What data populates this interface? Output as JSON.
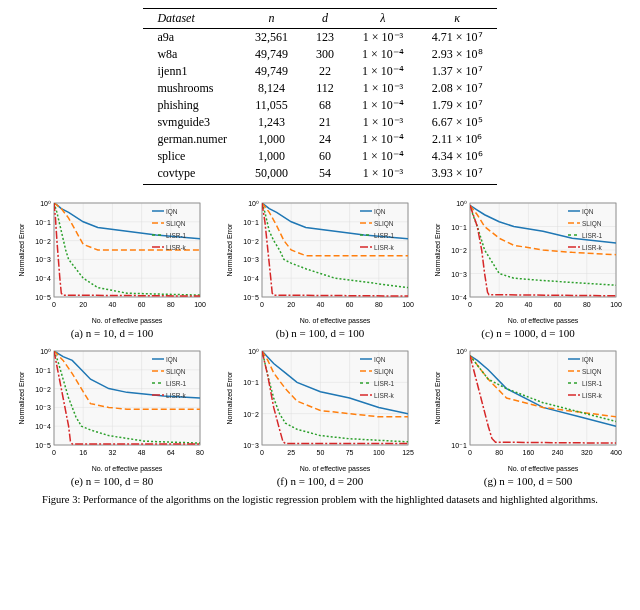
{
  "table": {
    "headers": [
      "Dataset",
      "n",
      "d",
      "λ",
      "κ"
    ],
    "rows": [
      [
        "a9a",
        "32,561",
        "123",
        "1 × 10⁻³",
        "4.71 × 10⁷"
      ],
      [
        "w8a",
        "49,749",
        "300",
        "1 × 10⁻⁴",
        "2.93 × 10⁸"
      ],
      [
        "ijenn1",
        "49,749",
        "22",
        "1 × 10⁻⁴",
        "1.37 × 10⁷"
      ],
      [
        "mushrooms",
        "8,124",
        "112",
        "1 × 10⁻³",
        "2.08 × 10⁷"
      ],
      [
        "phishing",
        "11,055",
        "68",
        "1 × 10⁻⁴",
        "1.79 × 10⁷"
      ],
      [
        "svmguide3",
        "1,243",
        "21",
        "1 × 10⁻³",
        "6.67 × 10⁵"
      ],
      [
        "german.numer",
        "1,000",
        "24",
        "1 × 10⁻⁴",
        "2.11 × 10⁶"
      ],
      [
        "splice",
        "1,000",
        "60",
        "1 × 10⁻⁴",
        "4.34 × 10⁶"
      ],
      [
        "covtype",
        "50,000",
        "54",
        "1 × 10⁻³",
        "3.93 × 10⁷"
      ]
    ]
  },
  "charts": {
    "captions": [
      "(a) n = 10, d = 100",
      "(b) n = 100, d = 100",
      "(c) n = 1000, d = 100",
      "(e) n = 100, d = 80",
      "(f) n = 100, d = 200",
      "(g) n = 100, d = 500"
    ],
    "legend": {
      "IQN": {
        "color": "#1f77b4",
        "dash": "solid"
      },
      "SLIQN": {
        "color": "#ff7f0e",
        "dash": "dashed"
      },
      "LISR-1": {
        "color": "#2ca02c",
        "dash": "dotted"
      },
      "LISR-k": {
        "color": "#d62728",
        "dash": "dashdot"
      }
    },
    "y_label": "Normalized Error",
    "x_label": "No. of effective passes"
  },
  "figure_caption": "Figure 3: Performance of the algorithms on the logistic regression problem with the highlighted datasets and highlighted algorithms."
}
